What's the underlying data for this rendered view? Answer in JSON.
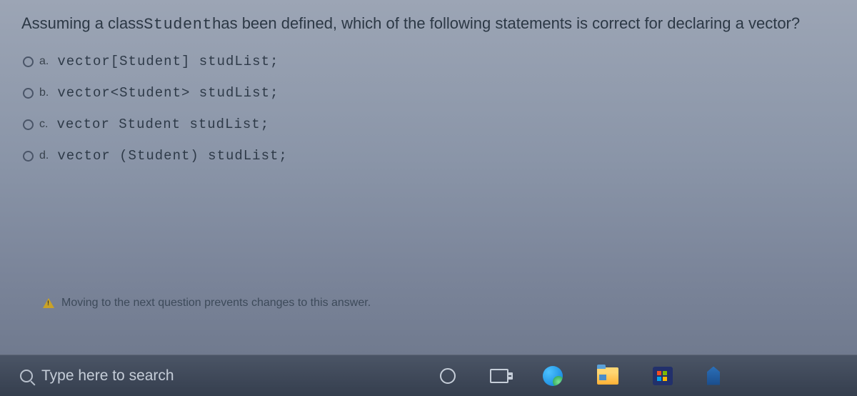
{
  "question": {
    "prefix": "Assuming a class",
    "classname": "Student",
    "suffix": "has been defined, which of the following statements is correct for declaring a vector?"
  },
  "options": [
    {
      "letter": "a.",
      "code": "vector[Student] studList;"
    },
    {
      "letter": "b.",
      "code": "vector<Student> studList;"
    },
    {
      "letter": "c.",
      "code": "vector Student studList;"
    },
    {
      "letter": "d.",
      "code": "vector (Student) studList;"
    }
  ],
  "warning": "Moving to the next question prevents changes to this answer.",
  "taskbar": {
    "search_placeholder": "Type here to search"
  }
}
